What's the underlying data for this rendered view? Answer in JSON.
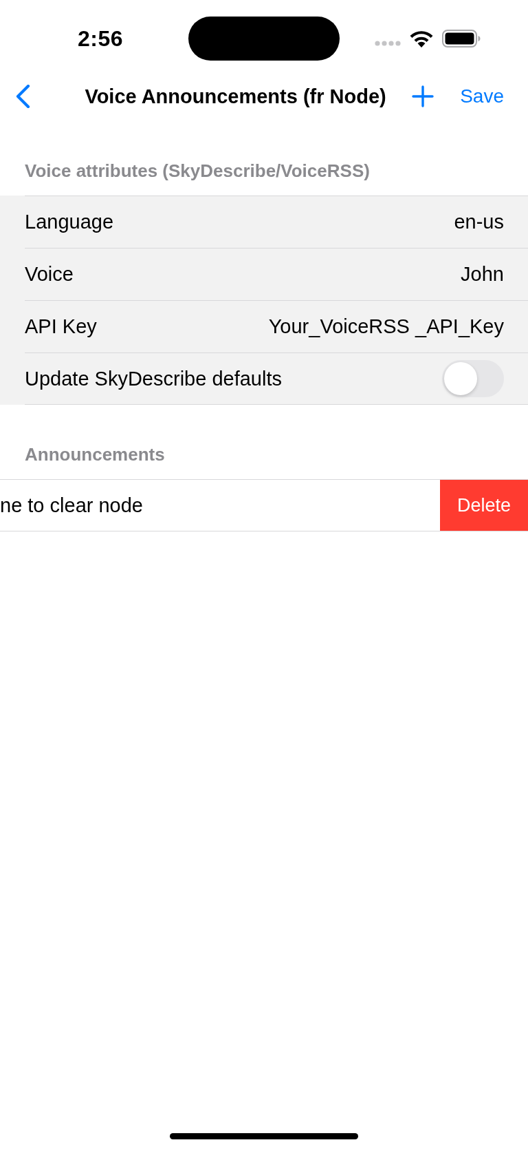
{
  "status_bar": {
    "time": "2:56"
  },
  "nav_bar": {
    "title": "Voice Announcements (fr Node)",
    "save": "Save"
  },
  "sections": [
    {
      "kind": "grouped",
      "header": "Voice attributes (SkyDescribe/VoiceRSS)",
      "rows": [
        {
          "kind": "value",
          "label": "Language",
          "value": "en-us"
        },
        {
          "kind": "value",
          "label": "Voice",
          "value": "John"
        },
        {
          "kind": "value",
          "label": "API Key",
          "value": "Your_VoiceRSS _API_Key"
        },
        {
          "kind": "toggle",
          "label": "Update SkyDescribe defaults",
          "on": false
        }
      ]
    },
    {
      "kind": "plain",
      "header": "Announcements",
      "rows": [
        {
          "kind": "swiped",
          "label": "ne to clear node",
          "action": "Delete"
        }
      ]
    }
  ]
}
